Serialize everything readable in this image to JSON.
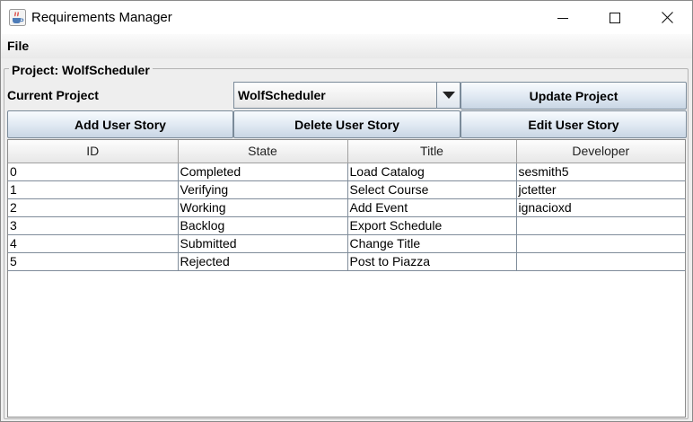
{
  "window": {
    "title": "Requirements Manager",
    "icon": "java-cup-icon"
  },
  "menu": {
    "file_label": "File"
  },
  "panel": {
    "title": "Project: WolfScheduler",
    "current_project_label": "Current Project",
    "project_select_value": "WolfScheduler",
    "update_button": "Update Project",
    "add_button": "Add User Story",
    "delete_button": "Delete User Story",
    "edit_button": "Edit User Story"
  },
  "table": {
    "columns": [
      "ID",
      "State",
      "Title",
      "Developer"
    ],
    "rows": [
      [
        "0",
        "Completed",
        "Load Catalog",
        "sesmith5"
      ],
      [
        "1",
        "Verifying",
        "Select Course",
        "jctetter"
      ],
      [
        "2",
        "Working",
        "Add Event",
        "ignacioxd"
      ],
      [
        "3",
        "Backlog",
        "Export Schedule",
        ""
      ],
      [
        "4",
        "Submitted",
        "Change Title",
        ""
      ],
      [
        "5",
        "Rejected",
        "Post to Piazza",
        ""
      ]
    ]
  }
}
